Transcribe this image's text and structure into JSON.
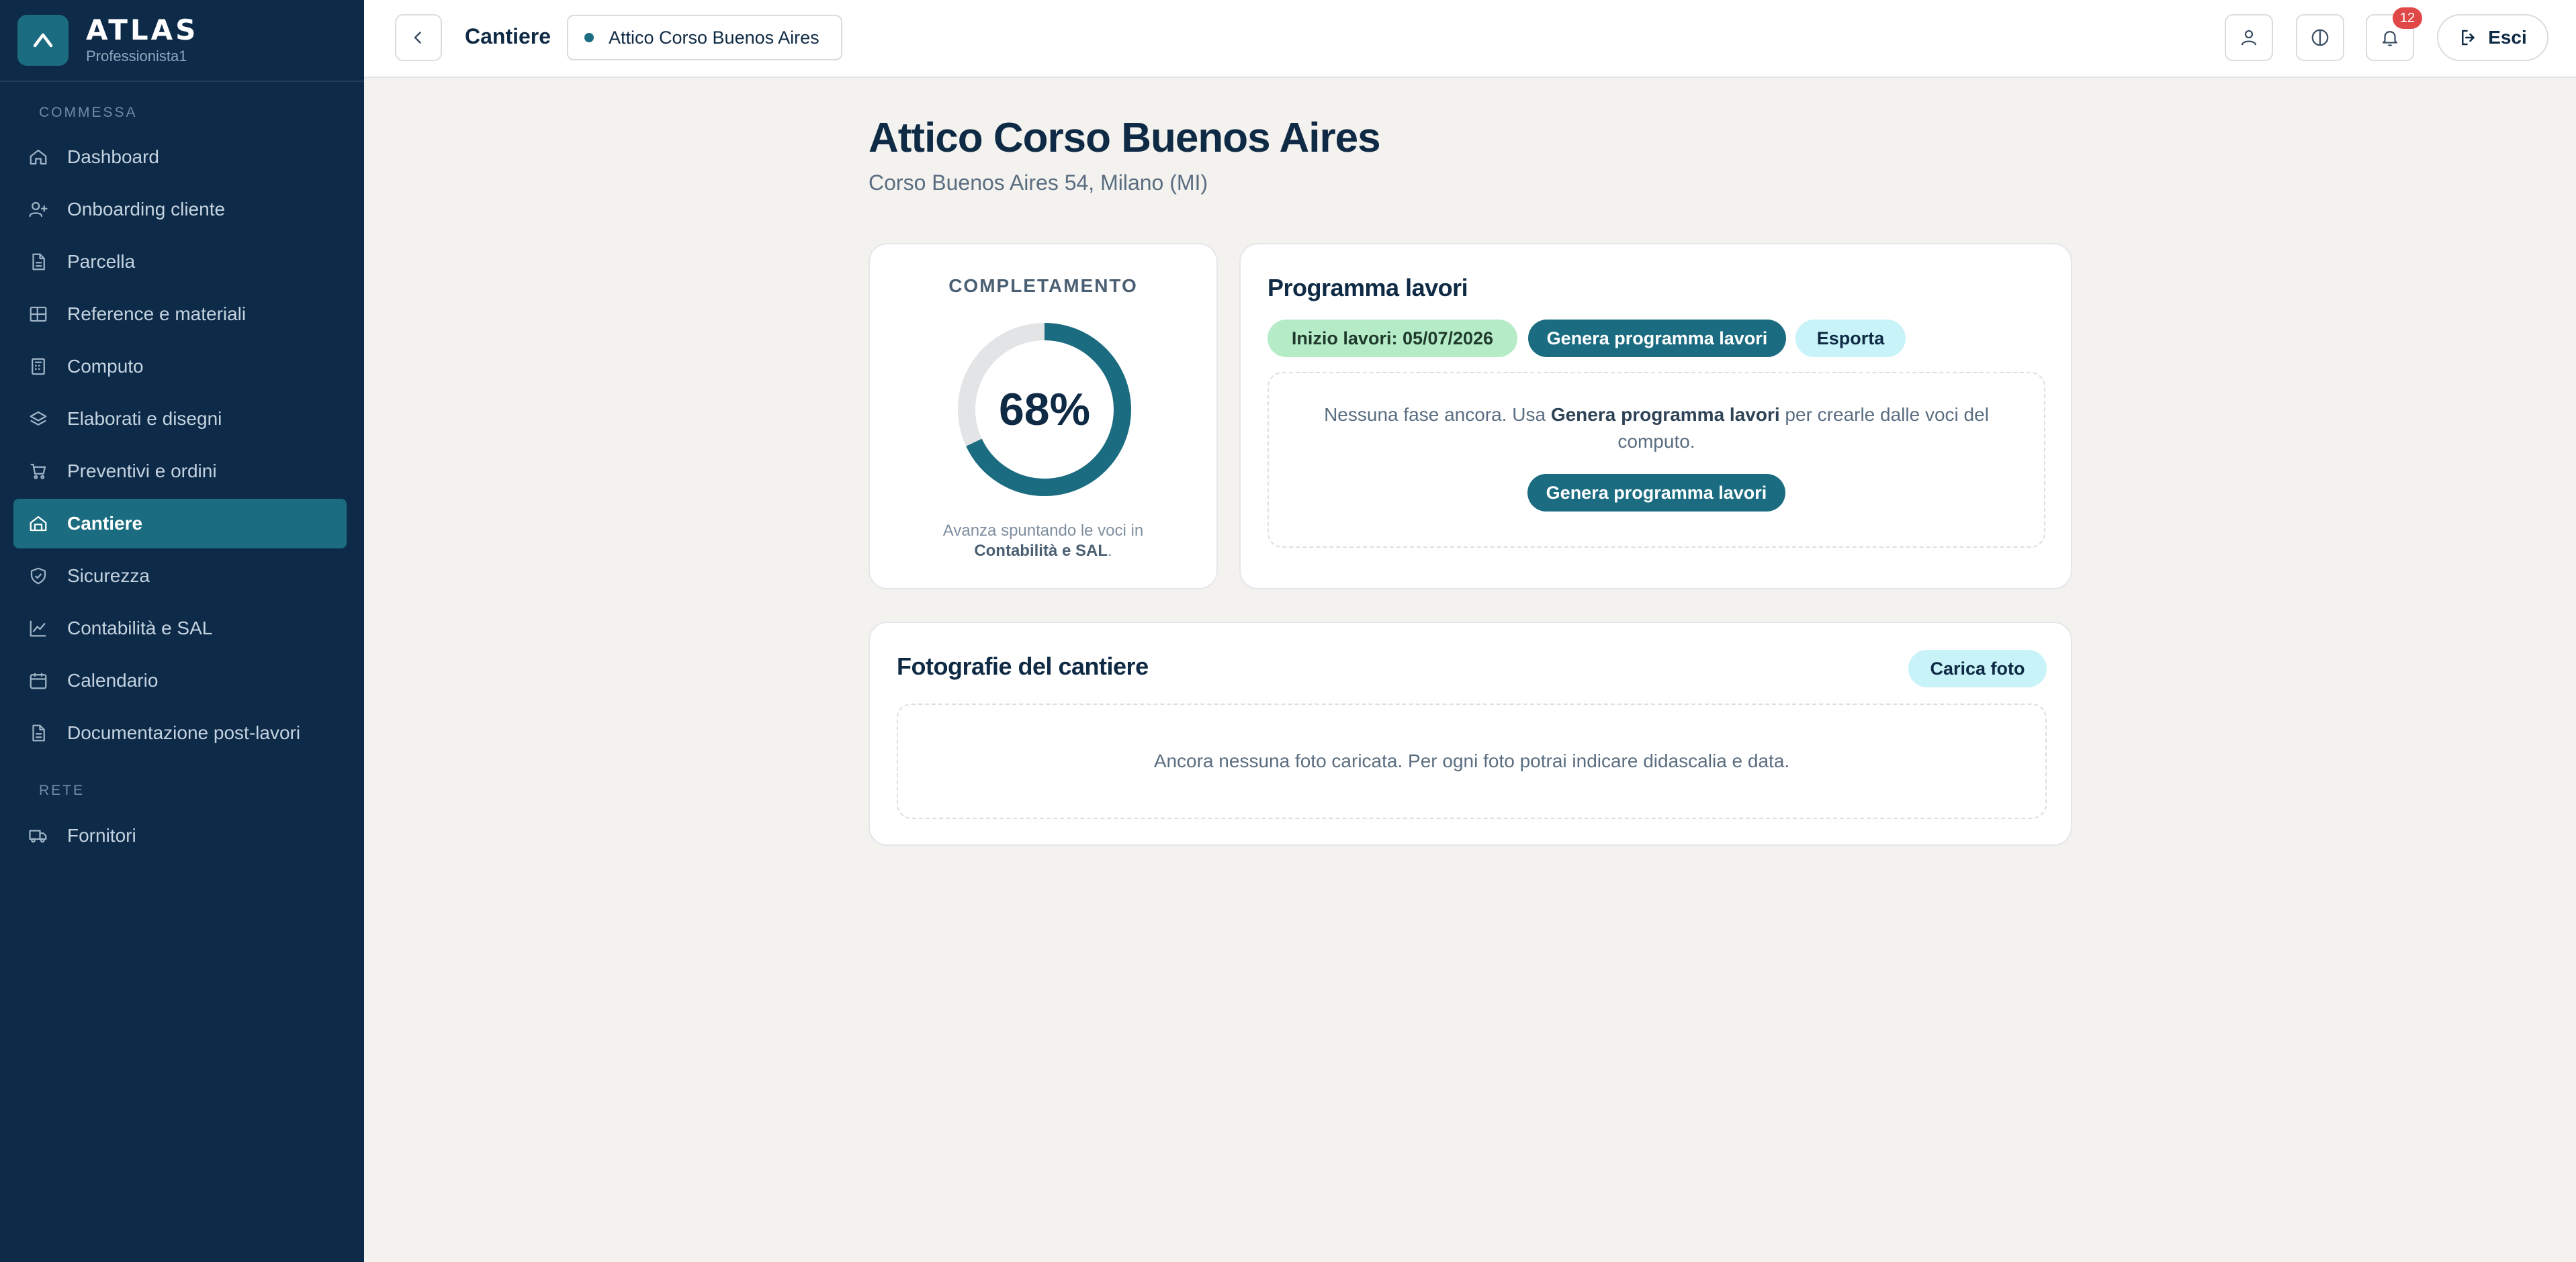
{
  "brand": {
    "name": "ATLAS",
    "subtitle": "Professionista1"
  },
  "sidebar": {
    "section_commessa": "COMMESSA",
    "items": [
      {
        "label": "Dashboard",
        "icon": "home-icon"
      },
      {
        "label": "Onboarding cliente",
        "icon": "user-plus-icon"
      },
      {
        "label": "Parcella",
        "icon": "document-icon"
      },
      {
        "label": "Reference e materiali",
        "icon": "grid-icon"
      },
      {
        "label": "Computo",
        "icon": "calculator-icon"
      },
      {
        "label": "Elaborati e disegni",
        "icon": "layers-icon"
      },
      {
        "label": "Preventivi e ordini",
        "icon": "cart-icon"
      },
      {
        "label": "Cantiere",
        "icon": "site-icon",
        "active": true
      },
      {
        "label": "Sicurezza",
        "icon": "shield-check-icon"
      },
      {
        "label": "Contabilità e SAL",
        "icon": "chart-line-icon"
      },
      {
        "label": "Calendario",
        "icon": "calendar-icon"
      },
      {
        "label": "Documentazione post-lavori",
        "icon": "document-icon"
      }
    ],
    "section_rete": "RETE",
    "rete_items": [
      {
        "label": "Fornitori",
        "icon": "truck-icon"
      }
    ]
  },
  "topbar": {
    "title": "Cantiere",
    "project": "Attico Corso Buenos Aires",
    "notifications_count": "12",
    "exit_label": "Esci"
  },
  "page": {
    "title": "Attico Corso Buenos Aires",
    "subtitle": "Corso Buenos Aires 54, Milano (MI)"
  },
  "completion": {
    "label": "COMPLETAMENTO",
    "percent": 68,
    "percent_text": "68%",
    "note_prefix": "Avanza spuntando le voci in",
    "note_link": "Contabilità e SAL",
    "note_suffix": "."
  },
  "program": {
    "title": "Programma lavori",
    "start_pill": "Inizio lavori: 05/07/2026",
    "generate_label": "Genera programma lavori",
    "export_label": "Esporta",
    "empty_prefix": "Nessuna fase ancora. Usa ",
    "empty_bold": "Genera programma lavori",
    "empty_suffix": " per crearle dalle voci del computo.",
    "empty_button": "Genera programma lavori"
  },
  "photos": {
    "title": "Fotografie del cantiere",
    "upload_label": "Carica foto",
    "empty_text": "Ancora nessuna foto caricata. Per ogni foto potrai indicare didascalia e data."
  },
  "colors": {
    "sidebar_bg": "#0d2a48",
    "accent": "#1b6c80",
    "ring_track": "#e2e4e6",
    "badge": "#e04848",
    "pill_green": "#b5ecc7",
    "pill_cyan": "#c8f3f8"
  }
}
